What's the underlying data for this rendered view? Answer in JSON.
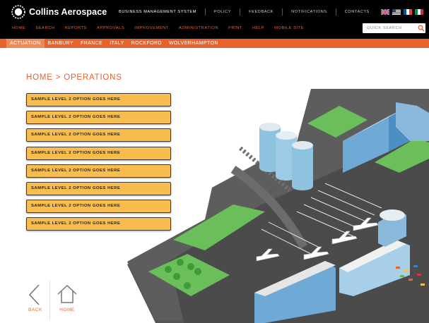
{
  "brand": {
    "name": "Collins Aerospace"
  },
  "utility_nav": [
    "BUSINESS MANAGEMENT SYSTEM",
    "POLICY",
    "FEEDBACK",
    "NOTIFICATIONS",
    "CONTACTS"
  ],
  "flags": [
    "uk-flag-icon",
    "us-flag-icon",
    "france-flag-icon",
    "italy-flag-icon"
  ],
  "main_nav": [
    "HOME",
    "SEARCH",
    "REPORTS",
    "APPROVALS",
    "IMPROVEMENT",
    "ADMINISTRATION",
    "PRINT",
    "HELP",
    "MOBILE SITE"
  ],
  "search": {
    "placeholder": "QUICK SEARCH",
    "icon": "search-icon"
  },
  "sub_nav": {
    "items": [
      "ACTUATION",
      "BANBURY",
      "FRANCE",
      "ITALY",
      "ROCKFORD",
      "WOLVERHAMPTON"
    ],
    "active": "ACTUATION"
  },
  "breadcrumb": "HOME > OPERATIONS",
  "options": [
    "SAMPLE LEVEL 2 OPTION GOES HERE",
    "SAMPLE LEVEL 2 OPTION GOES HERE",
    "SAMPLE LEVEL 2 OPTION GOES HERE",
    "SAMPLE LEVEL 2 OPTION GOES HERE",
    "SAMPLE LEVEL 2 OPTION GOES HERE",
    "SAMPLE LEVEL 2 OPTION GOES HERE",
    "SAMPLE LEVEL 2 OPTION GOES HERE",
    "SAMPLE LEVEL 2 OPTION GOES HERE"
  ],
  "bottom_nav": {
    "back": "BACK",
    "home": "HOME"
  },
  "colors": {
    "accent": "#e8622c",
    "option_fill": "#f9bd4f",
    "header_bg": "#000000"
  }
}
